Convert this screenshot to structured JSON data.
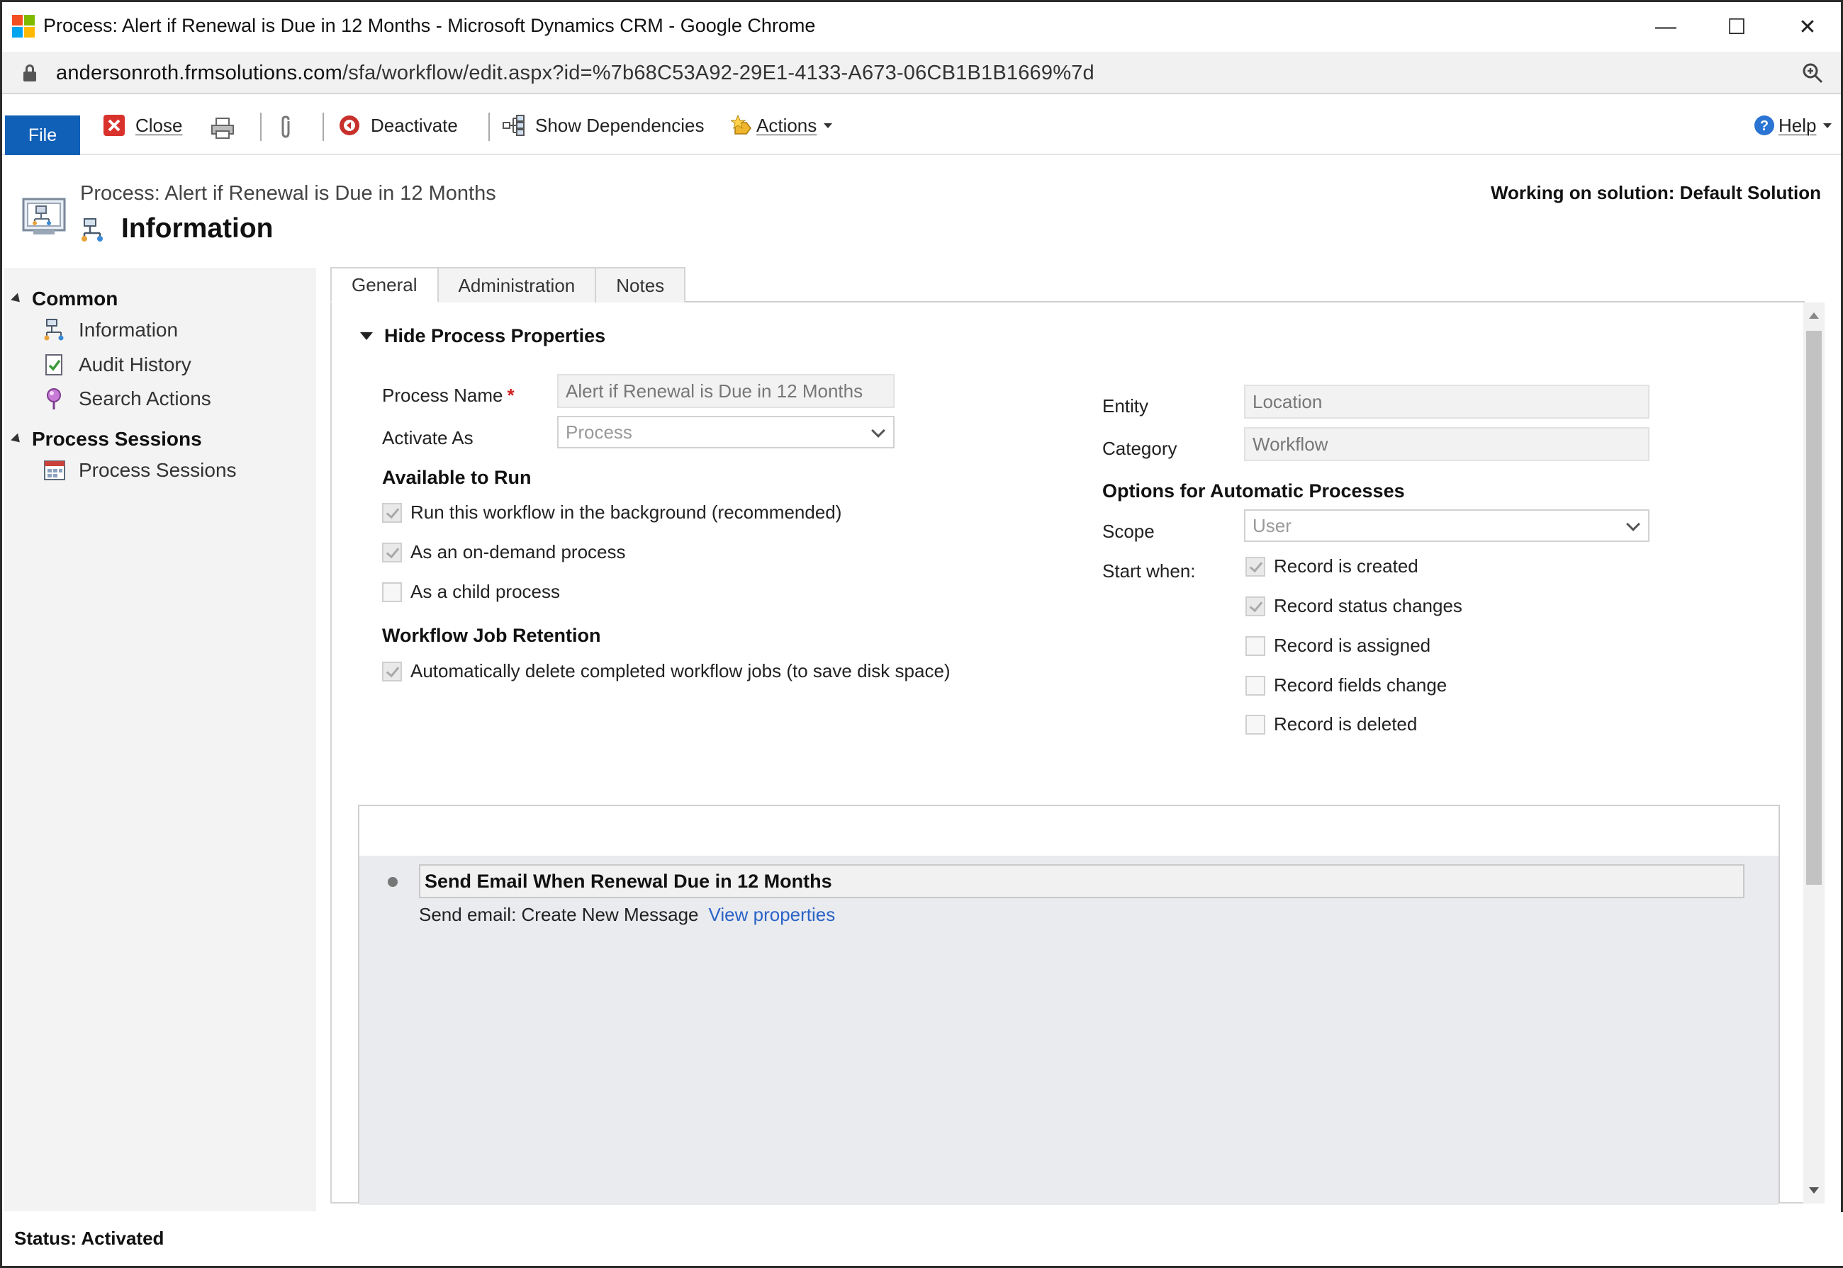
{
  "window": {
    "title": "Process: Alert if Renewal is Due in 12 Months - Microsoft Dynamics CRM - Google Chrome",
    "minimize_glyph": "—",
    "maximize_glyph": "☐",
    "close_glyph": "✕"
  },
  "address": {
    "host": "andersonroth.frmsolutions.com",
    "path": "/sfa/workflow/edit.aspx?id=%7b68C53A92-29E1-4133-A673-06CB1B1B1669%7d"
  },
  "toolbar": {
    "file_label": "File",
    "close_label": "Close",
    "deactivate_label": "Deactivate",
    "show_dependencies_label": "Show Dependencies",
    "actions_label": "Actions",
    "help_label": "Help"
  },
  "header": {
    "subtitle": "Process: Alert if Renewal is Due in 12 Months",
    "title": "Information",
    "solution": "Working on solution: Default Solution"
  },
  "nav": {
    "groups": [
      {
        "label": "Common",
        "items": [
          "Information",
          "Audit History",
          "Search Actions"
        ]
      },
      {
        "label": "Process Sessions",
        "items": [
          "Process Sessions"
        ]
      }
    ]
  },
  "tabs": [
    "General",
    "Administration",
    "Notes"
  ],
  "properties": {
    "section_label": "Hide Process Properties",
    "process_name_label": "Process Name",
    "process_name_required": "*",
    "process_name_value": "Alert if Renewal is Due in 12 Months",
    "activate_as_label": "Activate As",
    "activate_as_value": "Process",
    "available_to_run_label": "Available to Run",
    "run_options": [
      {
        "label": "Run this workflow in the background (recommended)",
        "checked": true
      },
      {
        "label": "As an on-demand process",
        "checked": true
      },
      {
        "label": "As a child process",
        "checked": false
      }
    ],
    "retention_label": "Workflow Job Retention",
    "retention_option": {
      "label": "Automatically delete completed workflow jobs (to save disk space)",
      "checked": true
    },
    "entity_label": "Entity",
    "entity_value": "Location",
    "category_label": "Category",
    "category_value": "Workflow",
    "auto_options_label": "Options for Automatic Processes",
    "scope_label": "Scope",
    "scope_value": "User",
    "start_when_label": "Start when:",
    "start_when": [
      {
        "label": "Record is created",
        "checked": true
      },
      {
        "label": "Record status changes",
        "checked": true
      },
      {
        "label": "Record is assigned",
        "checked": false
      },
      {
        "label": "Record fields change",
        "checked": false
      },
      {
        "label": "Record is deleted",
        "checked": false
      }
    ]
  },
  "designer": {
    "step_title": "Send Email When Renewal Due in 12 Months",
    "step_action": "Send email:  Create New Message",
    "step_link": "View properties"
  },
  "status": {
    "text": "Status: Activated"
  },
  "colors": {
    "file_button": "#1160b7",
    "link": "#2b63c7",
    "required": "#d01f1f"
  }
}
